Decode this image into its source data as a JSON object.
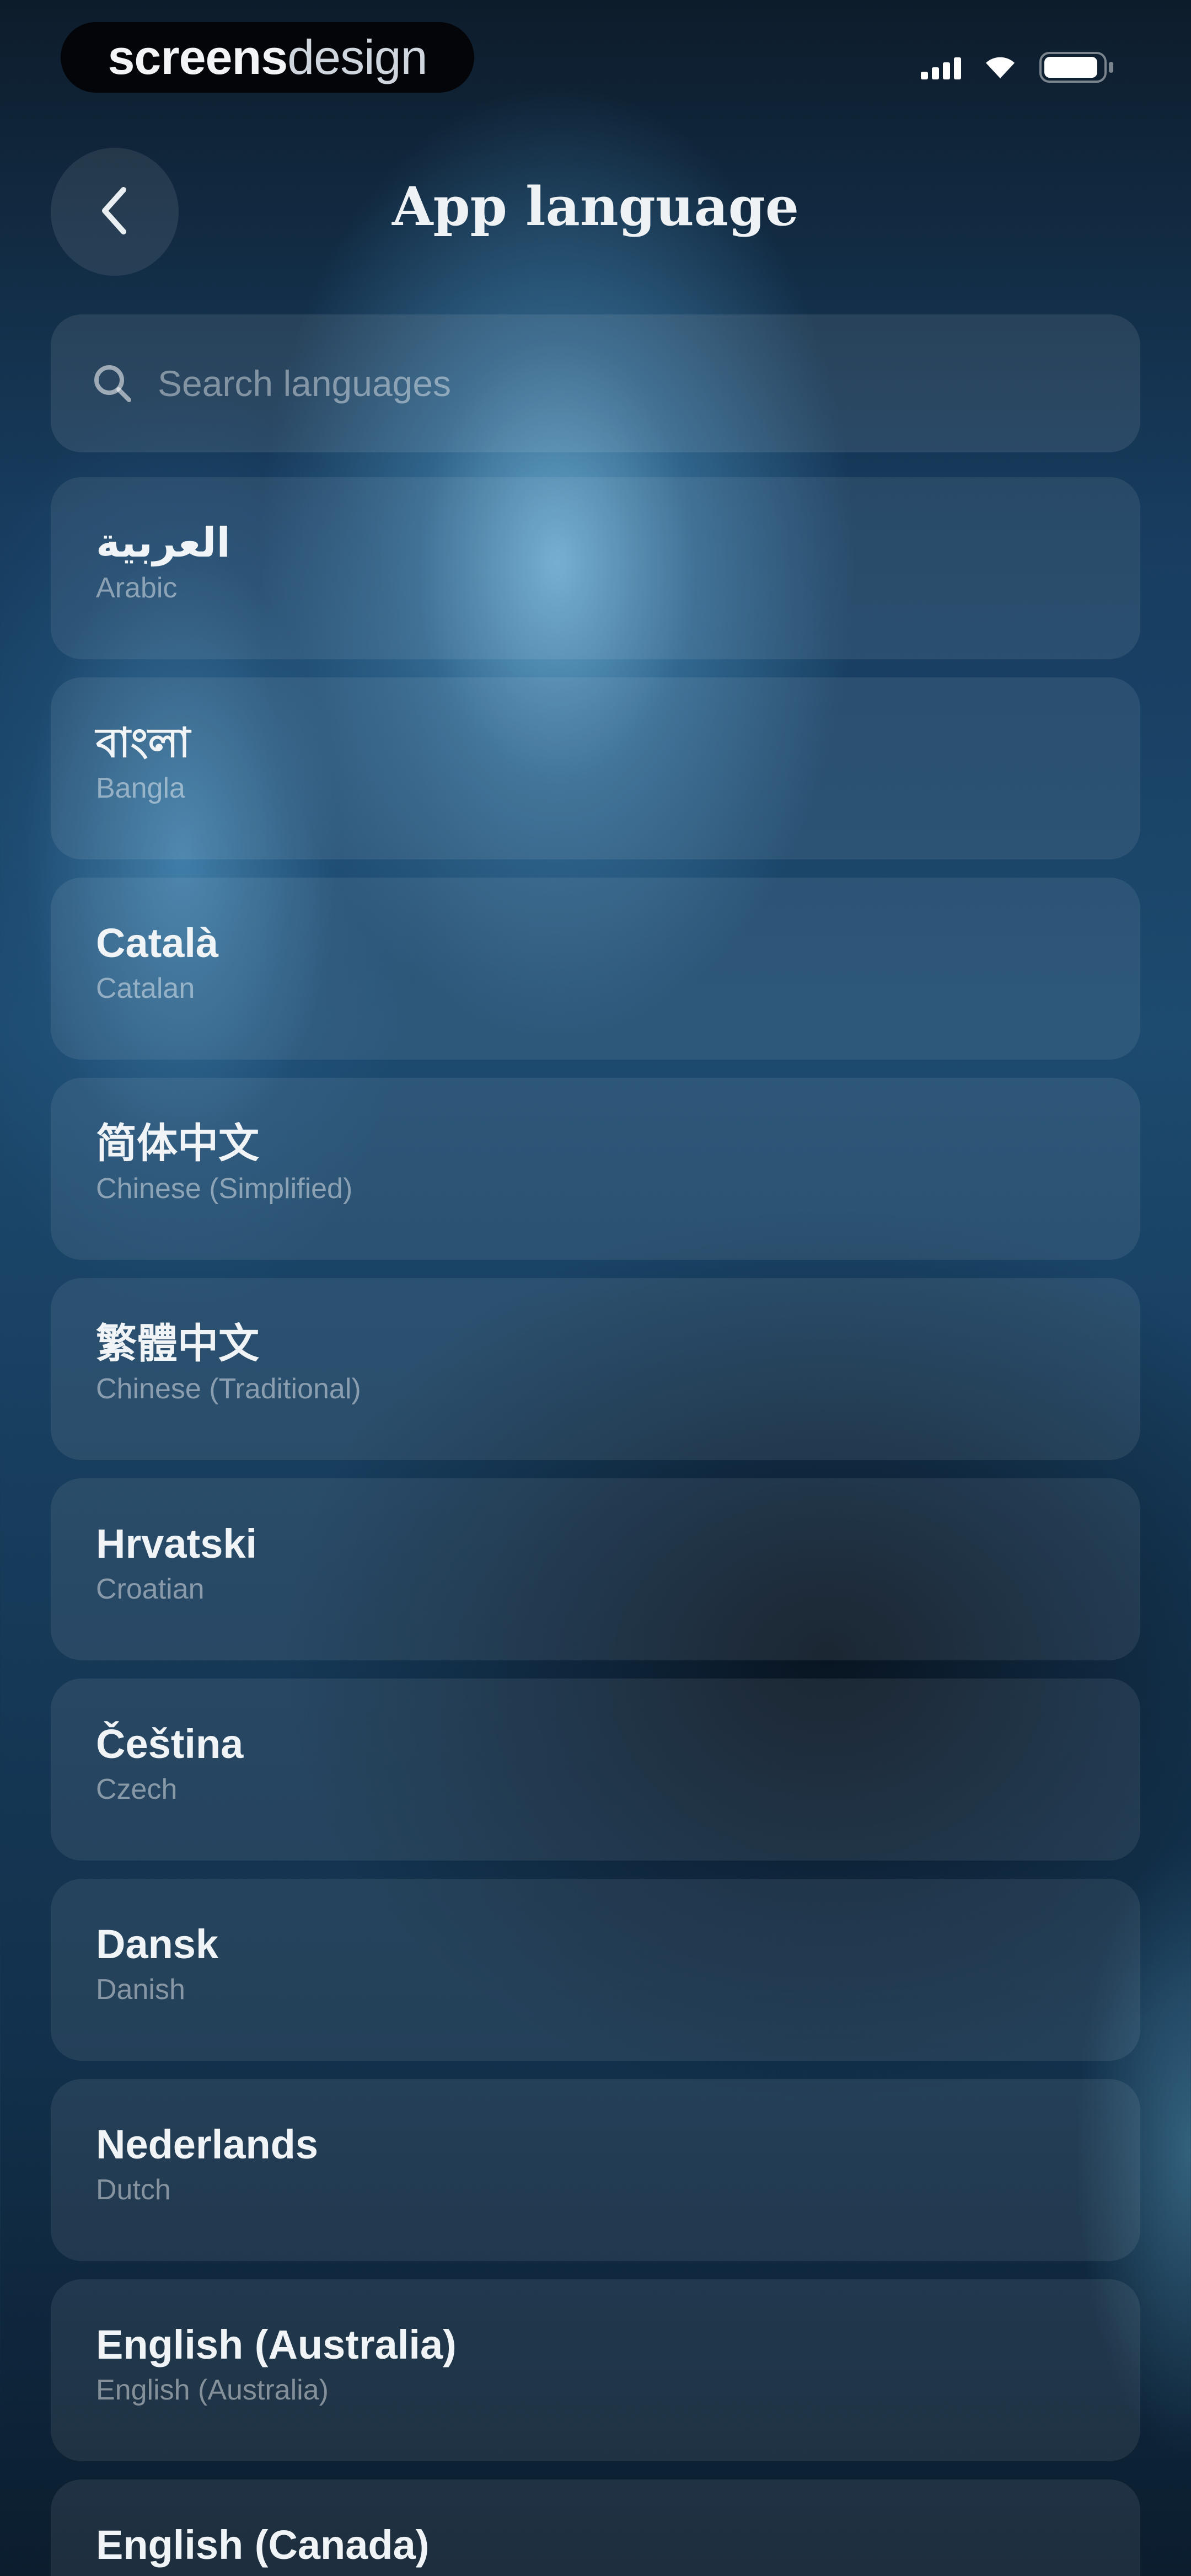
{
  "status_bar": {
    "brand_bold": "screens",
    "brand_light": "design",
    "icons": [
      "cellular-signal-icon",
      "wifi-icon",
      "battery-icon"
    ]
  },
  "header": {
    "title": "App language",
    "back_icon": "chevron-left-icon"
  },
  "search": {
    "placeholder": "Search languages",
    "icon": "search-icon"
  },
  "languages": [
    {
      "native": "العربية",
      "english": "Arabic"
    },
    {
      "native": "বাংলা",
      "english": "Bangla"
    },
    {
      "native": "Català",
      "english": "Catalan"
    },
    {
      "native": "简体中文",
      "english": "Chinese (Simplified)"
    },
    {
      "native": "繁體中文",
      "english": "Chinese (Traditional)"
    },
    {
      "native": "Hrvatski",
      "english": "Croatian"
    },
    {
      "native": "Čeština",
      "english": "Czech"
    },
    {
      "native": "Dansk",
      "english": "Danish"
    },
    {
      "native": "Nederlands",
      "english": "Dutch"
    },
    {
      "native": "English (Australia)",
      "english": "English (Australia)"
    },
    {
      "native": "English (Canada)",
      "english": ""
    }
  ],
  "colors": {
    "background_dark": "#0b1d2e",
    "glow_blue": "#70b2d7",
    "card": "rgba(255,255,255,0.08)",
    "text_primary": "#ffffff",
    "text_secondary": "rgba(255,255,255,0.45)"
  }
}
